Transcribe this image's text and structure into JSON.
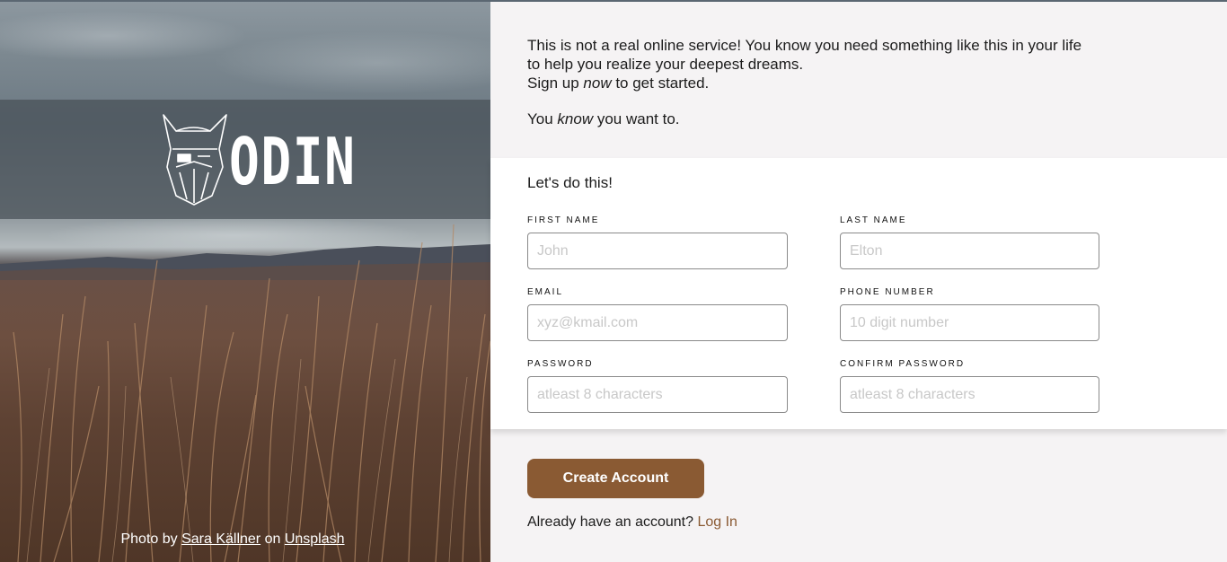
{
  "hero": {
    "logo_text": "ODIN",
    "credit_prefix": "Photo by",
    "credit_author": "Sara Källner",
    "credit_on": "on",
    "credit_site": "Unsplash"
  },
  "intro": {
    "line1": "This is not a real online service! You know you need something like this in your life",
    "line2": "to help you realize your deepest dreams.",
    "line3_before": "Sign up",
    "line3_em": "now",
    "line3_after": "to get started.",
    "line4_before": "You",
    "line4_em": "know",
    "line4_after": "you want to."
  },
  "form": {
    "heading": "Let's do this!",
    "first_name": {
      "label": "FIRST NAME",
      "placeholder": "John"
    },
    "last_name": {
      "label": "LAST NAME",
      "placeholder": "Elton"
    },
    "email": {
      "label": "EMAIL",
      "placeholder": "xyz@kmail.com"
    },
    "phone": {
      "label": "PHONE NUMBER",
      "placeholder": "10 digit number"
    },
    "password": {
      "label": "PASSWORD",
      "placeholder": "atleast 8 characters"
    },
    "confirm_password": {
      "label": "CONFIRM PASSWORD",
      "placeholder": "atleast 8 characters"
    }
  },
  "actions": {
    "create_label": "Create Account",
    "login_prompt": "Already have an account?",
    "login_link": "Log In"
  },
  "colors": {
    "accent": "#8a5a33",
    "panel": "#ffffff",
    "page": "#f5f3f4"
  }
}
